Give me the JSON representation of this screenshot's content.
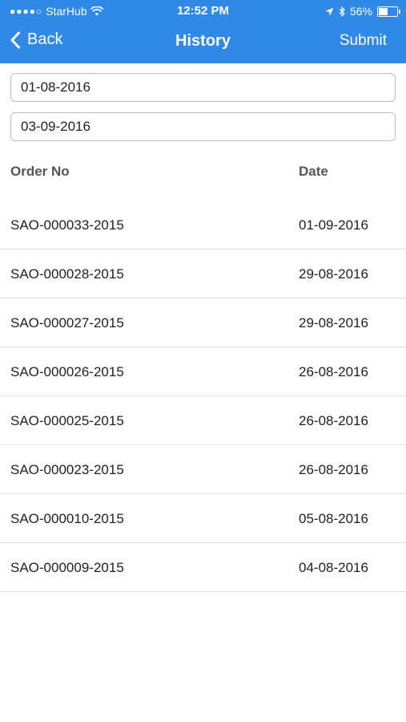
{
  "status_bar": {
    "signal_dots": "●●●●○",
    "carrier": "StarHub",
    "time": "12:52 PM",
    "battery_percent": "56%",
    "battery_level": 0.56
  },
  "nav": {
    "back_label": "Back",
    "title": "History",
    "submit_label": "Submit"
  },
  "filters": {
    "from_date": "01-08-2016",
    "to_date": "03-09-2016"
  },
  "table": {
    "headers": {
      "order_no": "Order No",
      "date": "Date"
    },
    "rows": [
      {
        "order_no": "SAO-000033-2015",
        "date": "01-09-2016"
      },
      {
        "order_no": "SAO-000028-2015",
        "date": "29-08-2016"
      },
      {
        "order_no": "SAO-000027-2015",
        "date": "29-08-2016"
      },
      {
        "order_no": "SAO-000026-2015",
        "date": "26-08-2016"
      },
      {
        "order_no": "SAO-000025-2015",
        "date": "26-08-2016"
      },
      {
        "order_no": "SAO-000023-2015",
        "date": "26-08-2016"
      },
      {
        "order_no": "SAO-000010-2015",
        "date": "05-08-2016"
      },
      {
        "order_no": "SAO-000009-2015",
        "date": "04-08-2016"
      }
    ]
  },
  "colors": {
    "nav_background": "#2e8ae6",
    "nav_text": "#ffffff"
  }
}
